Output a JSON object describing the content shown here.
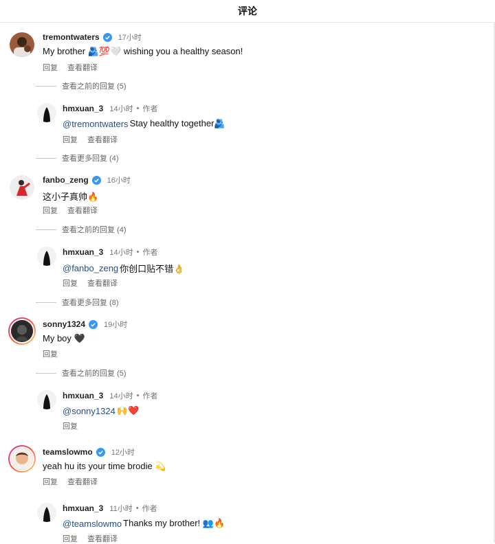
{
  "header": {
    "title": "评论"
  },
  "actions": {
    "reply": "回复",
    "translate": "查看翻译"
  },
  "threads": [
    {
      "user": "tremontwaters",
      "time": "17小时",
      "text": "My brother 🫂💯🤍 wishing you a healthy season!",
      "previous_replies": "查看之前的回复 (5)",
      "reply": {
        "user": "hmxuan_3",
        "time": "14小时",
        "author_badge": "作者",
        "mention": "@tremontwaters",
        "text": " Stay healthy together🫂"
      },
      "more_replies": "查看更多回复 (4)"
    },
    {
      "user": "fanbo_zeng",
      "time": "16小时",
      "text": "这小子真帅🔥",
      "previous_replies": "查看之前的回复 (4)",
      "reply": {
        "user": "hmxuan_3",
        "time": "14小时",
        "author_badge": "作者",
        "mention": "@fanbo_zeng",
        "text": " 你创口贴不错👌"
      },
      "more_replies": "查看更多回复 (8)"
    },
    {
      "user": "sonny1324",
      "time": "19小时",
      "text": "My boy 🖤",
      "previous_replies": "查看之前的回复 (5)",
      "reply": {
        "user": "hmxuan_3",
        "time": "14小时",
        "author_badge": "作者",
        "mention": "@sonny1324",
        "text": " 🙌❤️"
      }
    },
    {
      "user": "teamslowmo",
      "time": "12小时",
      "text": "yeah hu its your time brodie 💫",
      "reply": {
        "user": "hmxuan_3",
        "time": "11小时",
        "author_badge": "作者",
        "mention": "@teamslowmo",
        "text": " Thanks my brother! 👥🔥"
      }
    }
  ],
  "colors": {
    "mention": "#2a4e84",
    "verified": "#3897f0",
    "muted": "#777777"
  }
}
